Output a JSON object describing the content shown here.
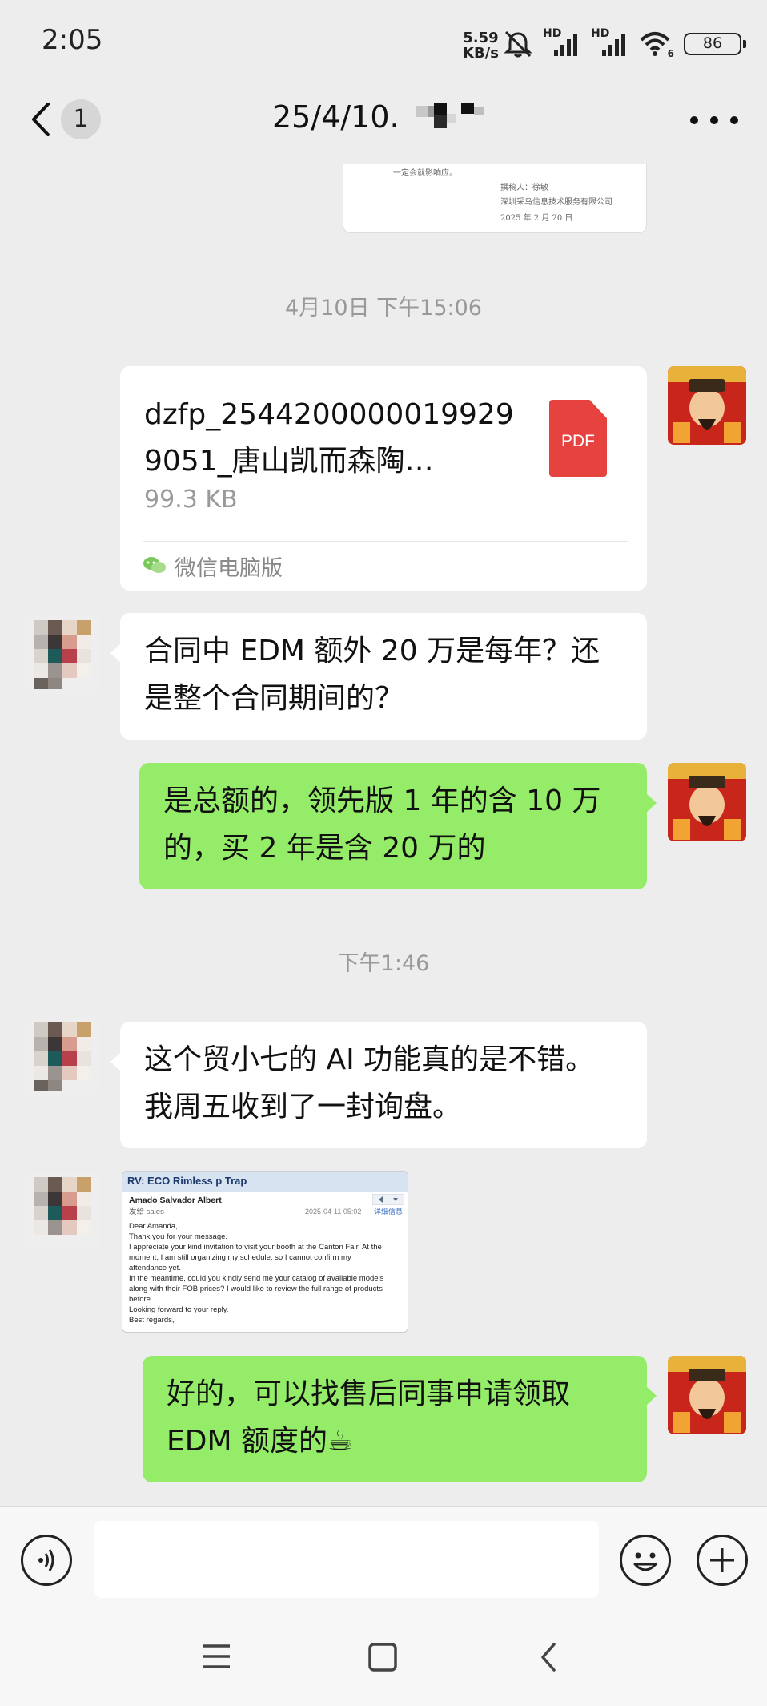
{
  "status_bar": {
    "time": "2:05",
    "net_speed_value": "5.59",
    "net_speed_unit": "KB/s",
    "signal_1_label": "HD",
    "signal_2_label": "HD",
    "wifi_label": "6",
    "battery": "86"
  },
  "header": {
    "unread_count": "1",
    "title": "25/4/10."
  },
  "document_snippet": {
    "line_1": "一定会就影响应。",
    "line_2": "撰稿人：徐敏",
    "line_3": "深圳采鸟信息技术服务有限公司",
    "line_4": "2025 年 2 月 20 日"
  },
  "messages": [
    {
      "type": "timestamp",
      "text": "4月10日 下午15:06"
    },
    {
      "type": "file",
      "sender": "me",
      "file_name": "dzfp_25442000000199299051_唐山凯而森陶…",
      "file_size": "99.3 KB",
      "file_icon": "PDF",
      "source": "微信电脑版"
    },
    {
      "type": "text",
      "sender": "other",
      "lines": [
        "合同中 EDM 额外 20 万是每年？还",
        "是整个合同期间的？"
      ]
    },
    {
      "type": "text",
      "sender": "me",
      "lines": [
        "是总额的，领先版 1 年的含 10 万",
        "的，买 2 年是含 20 万的"
      ]
    },
    {
      "type": "timestamp",
      "text": "下午1:46"
    },
    {
      "type": "text",
      "sender": "other",
      "lines": [
        "这个贸小七的 AI 功能真的是不错。",
        "我周五收到了一封询盘。"
      ]
    },
    {
      "type": "image",
      "sender": "other"
    },
    {
      "type": "text",
      "sender": "me",
      "lines": [
        "好的，可以找售后同事申请领取",
        "EDM 额度的☕"
      ]
    }
  ],
  "email_screenshot": {
    "subject": "RV: ECO Rimless p Trap",
    "from": "Amado Salvador Albert",
    "to": "发给 sales",
    "date": "2025-04-11 05:02",
    "details_link": "详细信息",
    "body": [
      "Dear Amanda,",
      "Thank you for your message.",
      "I appreciate your kind invitation to visit your booth at the Canton Fair. At the",
      "moment, I am still organizing my schedule, so I cannot confirm my",
      "attendance yet.",
      "In the meantime, could you kindly send me your catalog of available models",
      "along with their FOB prices? I would like to review the full range of products",
      "before.",
      "Looking forward to your reply.",
      "Best regards,"
    ]
  },
  "colors": {
    "background": "#ededed",
    "bubble_green": "#95ec69",
    "bubble_white": "#ffffff",
    "pdf_red": "#e64340",
    "timestamp_gray": "#999999"
  }
}
